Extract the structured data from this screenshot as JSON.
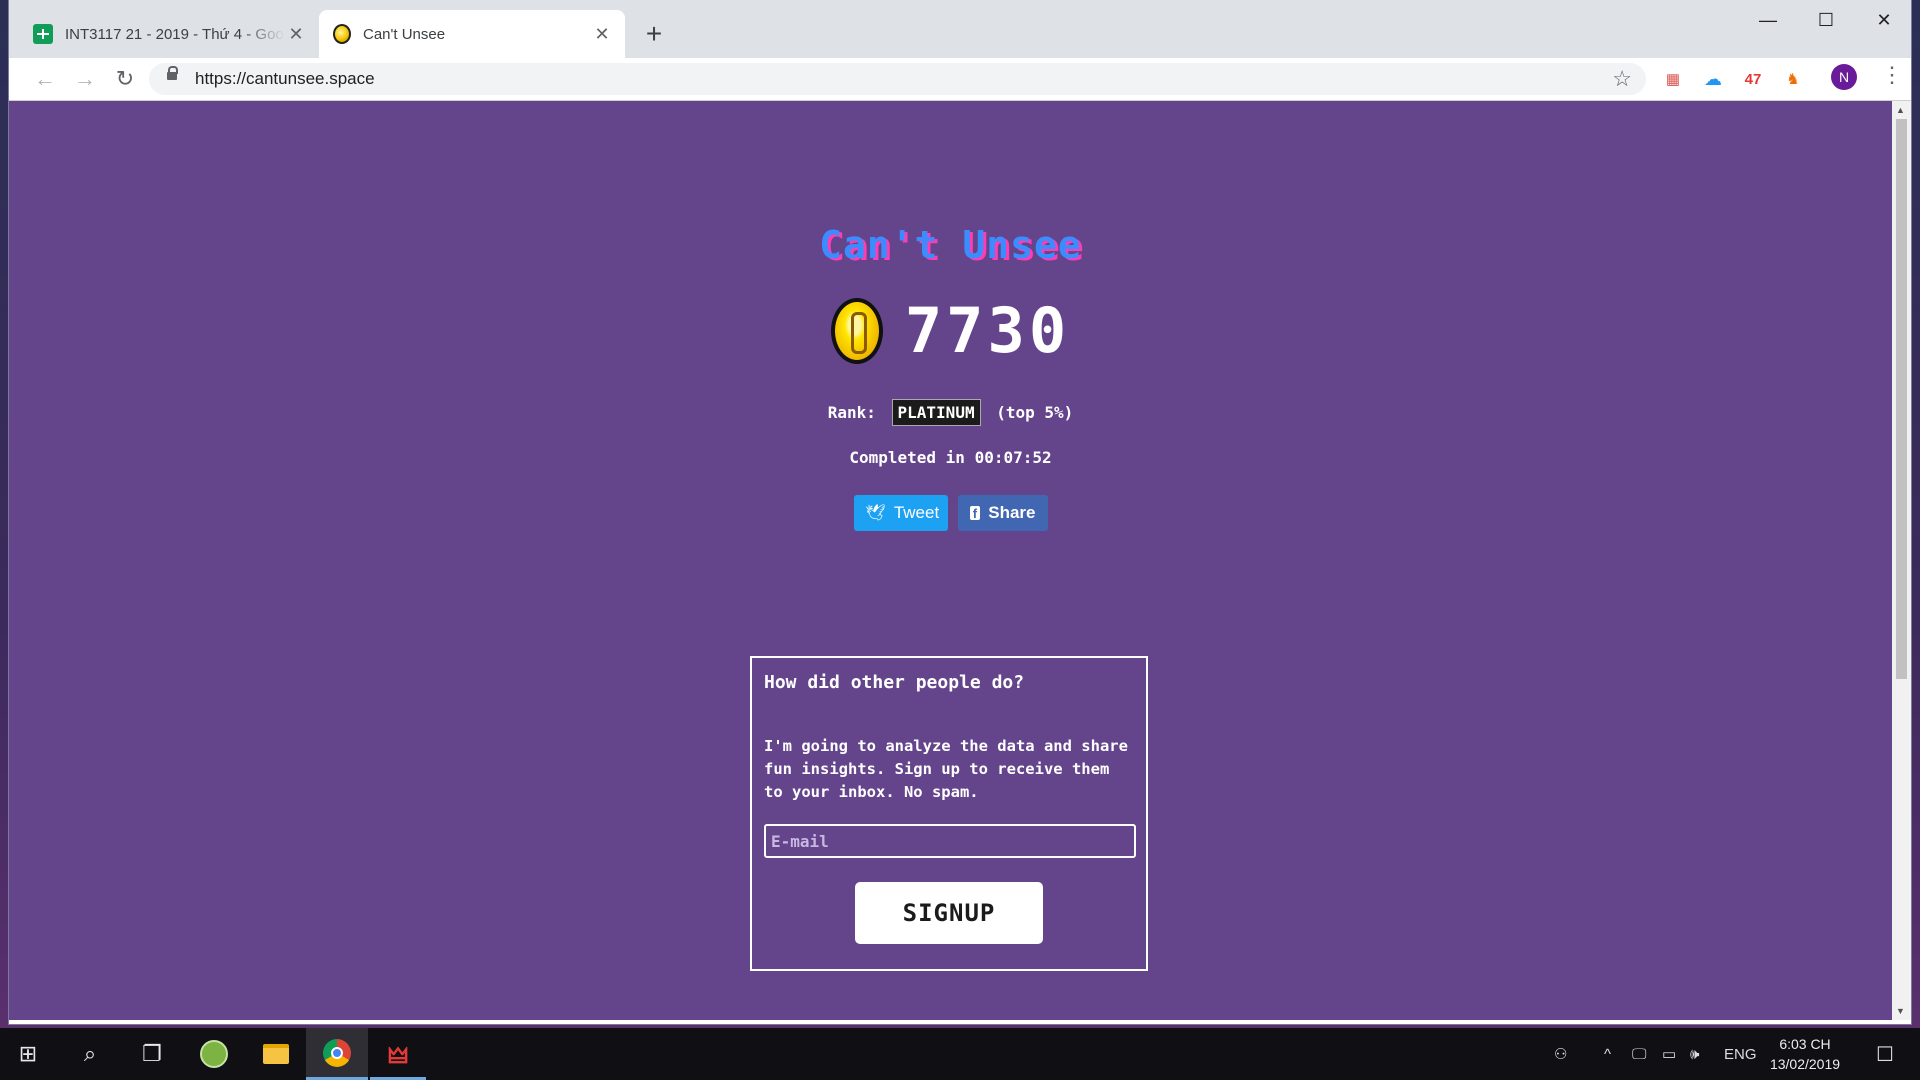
{
  "tabs": [
    {
      "title": "INT3117 21 - 2019 - Thứ 4 - Goo",
      "close": "✕",
      "active": false
    },
    {
      "title": "Can't Unsee",
      "close": "✕",
      "active": true
    }
  ],
  "new_tab": "+",
  "window_controls": {
    "minimize": "—",
    "maximize": "☐",
    "close": "✕"
  },
  "toolbar": {
    "back": "←",
    "forward": "→",
    "reload": "↻",
    "url": "https://cantunsee.space",
    "bookmark_star": "☆",
    "extensions": [
      {
        "name": "calendar-extension-icon",
        "glyph": "▦",
        "color": "#d9534f"
      },
      {
        "name": "cloud-extension-icon",
        "glyph": "☁",
        "color": "#2196f3"
      },
      {
        "name": "counter-extension",
        "glyph": "47",
        "color": "#e53935"
      },
      {
        "name": "fox-extension-icon",
        "glyph": "♞",
        "color": "#ef6c00"
      }
    ],
    "avatar_initial": "N",
    "menu": "⋮"
  },
  "page": {
    "logo": "Can't Unsee",
    "score": "7730",
    "rank_label": "Rank:",
    "rank_badge": "PLATINUM",
    "rank_suffix": "(top 5%)",
    "completed": "Completed in 00:07:52",
    "tweet_label": "Tweet",
    "share_label": "Share",
    "card": {
      "heading": "How did other people do?",
      "body": "I'm going to analyze the data and share fun insights. Sign up to receive them to your inbox. No spam.",
      "email_placeholder": "E-mail",
      "signup_label": "SIGNUP"
    }
  },
  "taskbar": {
    "start": "⊞",
    "search": "⌕",
    "task_view": "❐",
    "tray_arrow": "^",
    "language": "ENG",
    "time": "6:03 CH",
    "date": "13/02/2019",
    "notifications": "☐"
  }
}
